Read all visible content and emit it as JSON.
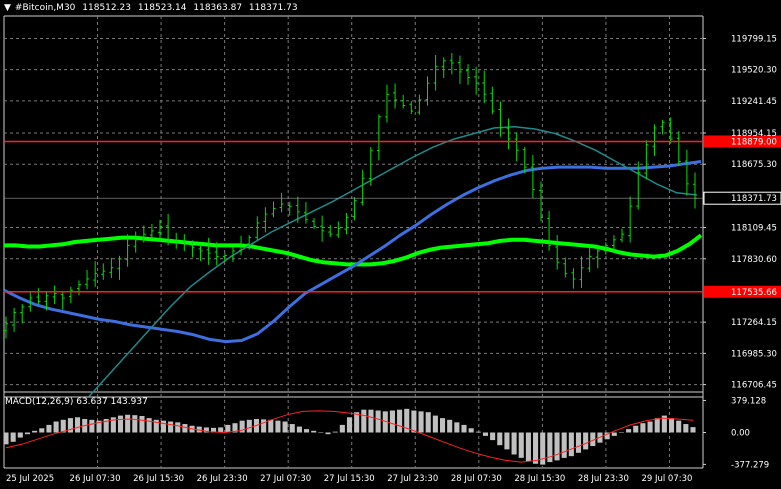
{
  "header": {
    "symbol": "#Bitcoin,M30",
    "open": "118512.23",
    "high": "118523.14",
    "low": "118363.87",
    "close": "118371.73",
    "menu_icon": "triangle-down-icon"
  },
  "colors": {
    "background": "#000000",
    "grid": "#7a7a7a",
    "candle": "#00e000",
    "ma_slow": "#00ff00",
    "ma_mid": "#3d6fe0",
    "ma_fast": "#1f8a8a",
    "level_line": "#ff2020",
    "level_box": "#ff0000",
    "macd_hist": "#c0c0c0",
    "macd_signal": "#ff2020",
    "price_box": "#000000"
  },
  "chart_data": [
    {
      "type": "line",
      "title": "#Bitcoin,M30",
      "grid": true,
      "y_axis_ticks": [
        "119799.15",
        "119520.30",
        "119241.45",
        "118954.15",
        "118675.30",
        "118109.45",
        "117830.60",
        "117264.15",
        "116985.30",
        "116706.45"
      ],
      "ylim": [
        116640,
        120000
      ],
      "x_axis_labels": [
        "25 Jul 2025",
        "26 Jul 07:30",
        "26 Jul 15:30",
        "26 Jul 23:30",
        "27 Jul 07:30",
        "27 Jul 15:30",
        "27 Jul 23:30",
        "28 Jul 07:30",
        "28 Jul 15:30",
        "28 Jul 23:30",
        "29 Jul 07:30"
      ],
      "horizontal_levels": [
        {
          "label": "118879.00",
          "value": 118879
        },
        {
          "label": "117535.66",
          "value": 117535.66
        }
      ],
      "current_price": {
        "label": "118371.73",
        "value": 118371.73
      },
      "closes": [
        117250,
        117350,
        117400,
        117480,
        117450,
        117500,
        117520,
        117480,
        117550,
        117600,
        117650,
        117700,
        117720,
        117750,
        117830,
        117950,
        118000,
        118050,
        118080,
        118120,
        118000,
        117980,
        117960,
        117930,
        117900,
        117880,
        117850,
        117860,
        117900,
        117950,
        118020,
        118150,
        118230,
        118280,
        118320,
        118300,
        118250,
        118180,
        118120,
        118080,
        118050,
        118100,
        118200,
        118350,
        118550,
        118800,
        119100,
        119300,
        119250,
        119200,
        119150,
        119250,
        119400,
        119550,
        119600,
        119580,
        119500,
        119450,
        119400,
        119300,
        119150,
        119000,
        118900,
        118800,
        118650,
        118450,
        118200,
        117950,
        117800,
        117700,
        117650,
        117750,
        117850,
        117900,
        117950,
        118000,
        118050,
        118300,
        118600,
        118850,
        119000,
        119050,
        118900,
        118700,
        118500,
        118371.73
      ],
      "series": [
        {
          "role": "slow moving average",
          "values": [
            117950,
            117950,
            117940,
            117940,
            117950,
            117960,
            117980,
            117990,
            118000,
            118010,
            118020,
            118020,
            118010,
            118000,
            117990,
            117980,
            117970,
            117960,
            117950,
            117950,
            117950,
            117940,
            117920,
            117900,
            117880,
            117850,
            117820,
            117800,
            117790,
            117780,
            117780,
            117780,
            117790,
            117810,
            117840,
            117880,
            117910,
            117930,
            117940,
            117950,
            117960,
            117970,
            117990,
            118000,
            118000,
            117990,
            117980,
            117970,
            117960,
            117950,
            117940,
            117920,
            117890,
            117870,
            117860,
            117850,
            117860,
            117900,
            117960,
            118040
          ]
        },
        {
          "role": "middle moving average",
          "values": [
            117550,
            117480,
            117420,
            117380,
            117350,
            117320,
            117290,
            117270,
            117240,
            117220,
            117200,
            117180,
            117150,
            117110,
            117090,
            117100,
            117160,
            117270,
            117400,
            117520,
            117600,
            117680,
            117760,
            117850,
            117940,
            118040,
            118130,
            118230,
            118320,
            118400,
            118470,
            118530,
            118580,
            118620,
            118640,
            118650,
            118650,
            118650,
            118640,
            118640,
            118640,
            118650,
            118660,
            118680,
            118700
          ]
        },
        {
          "role": "fast moving average",
          "values": [
            116600,
            116800,
            117000,
            117200,
            117400,
            117580,
            117720,
            117850,
            117960,
            118070,
            118160,
            118250,
            118340,
            118440,
            118540,
            118640,
            118740,
            118830,
            118900,
            118950,
            119000,
            119010,
            118990,
            118950,
            118880,
            118800,
            118700,
            118600,
            118500,
            118420,
            118400
          ]
        }
      ]
    },
    {
      "type": "bar",
      "title": "MACD(12,26,9) 63.637 143.937",
      "indicator_label": "MACD(12,26,9)",
      "main_value": "63.637",
      "signal_value": "143.937",
      "y_axis_ticks": [
        "379.128",
        "0.00",
        "-377.279"
      ],
      "ylim": [
        -420,
        420
      ],
      "histogram": [
        -140,
        -110,
        -60,
        -20,
        20,
        50,
        90,
        130,
        150,
        170,
        180,
        160,
        150,
        140,
        160,
        180,
        200,
        210,
        205,
        195,
        170,
        150,
        140,
        130,
        120,
        100,
        80,
        70,
        60,
        55,
        60,
        90,
        110,
        140,
        150,
        160,
        155,
        150,
        140,
        130,
        100,
        70,
        40,
        20,
        0,
        -20,
        10,
        90,
        180,
        240,
        270,
        270,
        260,
        250,
        260,
        270,
        280,
        260,
        250,
        240,
        200,
        170,
        150,
        120,
        90,
        50,
        10,
        -40,
        -90,
        -150,
        -200,
        -260,
        -300,
        -340,
        -370,
        -380,
        -350,
        -330,
        -300,
        -280,
        -240,
        -200,
        -160,
        -120,
        -80,
        -40,
        0,
        40,
        80,
        110,
        130,
        170,
        200,
        170,
        140,
        100,
        63.637
      ],
      "signal": [
        -180,
        -140,
        -80,
        -20,
        30,
        80,
        120,
        150,
        160,
        140,
        110,
        80,
        40,
        10,
        0,
        20,
        80,
        150,
        210,
        250,
        255,
        250,
        230,
        200,
        150,
        90,
        30,
        -40,
        -110,
        -180,
        -240,
        -290,
        -330,
        -350,
        -330,
        -280,
        -210,
        -140,
        -60,
        20,
        90,
        140,
        170,
        160,
        143.937
      ]
    }
  ]
}
